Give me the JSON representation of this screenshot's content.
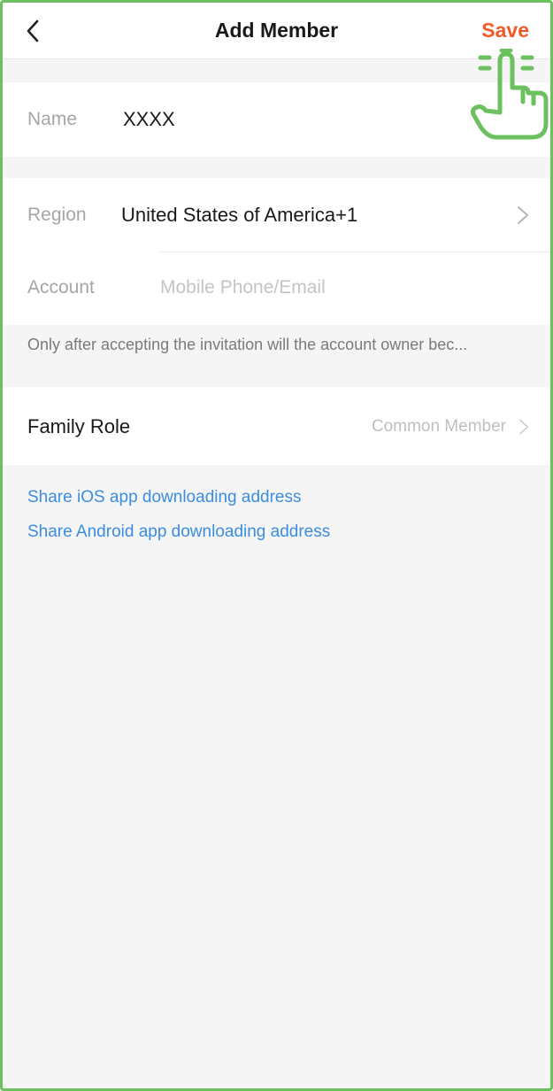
{
  "header": {
    "title": "Add Member",
    "save_label": "Save",
    "back_icon": "chevron-left-icon"
  },
  "name_row": {
    "label": "Name",
    "value": "XXXX"
  },
  "region_row": {
    "label": "Region",
    "value": "United States of America+1",
    "icon": "chevron-right-icon"
  },
  "account_row": {
    "label": "Account",
    "placeholder": "Mobile Phone/Email",
    "value": ""
  },
  "hint": "Only after accepting the invitation will the account owner bec...",
  "role_row": {
    "label": "Family Role",
    "value": "Common Member",
    "icon": "chevron-right-icon"
  },
  "links": [
    "Share iOS app downloading address",
    "Share Android app downloading address"
  ],
  "colors": {
    "accent": "#f05a28",
    "link": "#3b8de0",
    "highlight": "#6cc060"
  }
}
